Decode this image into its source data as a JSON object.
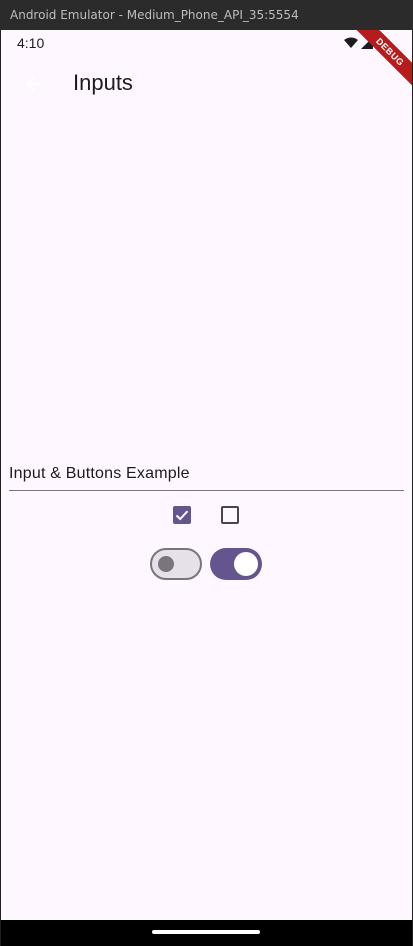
{
  "window": {
    "title": "Android Emulator - Medium_Phone_API_35:5554"
  },
  "status_bar": {
    "time": "4:10",
    "debug_banner": "DEBUG"
  },
  "app_bar": {
    "title": "Inputs"
  },
  "form": {
    "text_field": {
      "placeholder": "Input & Buttons Example",
      "value": ""
    },
    "checkboxes": [
      {
        "checked": true
      },
      {
        "checked": false
      }
    ],
    "switches": [
      {
        "on": false
      },
      {
        "on": true
      }
    ]
  },
  "colors": {
    "primary": "#65558f",
    "background": "#fef7ff",
    "outline": "#79747e"
  }
}
